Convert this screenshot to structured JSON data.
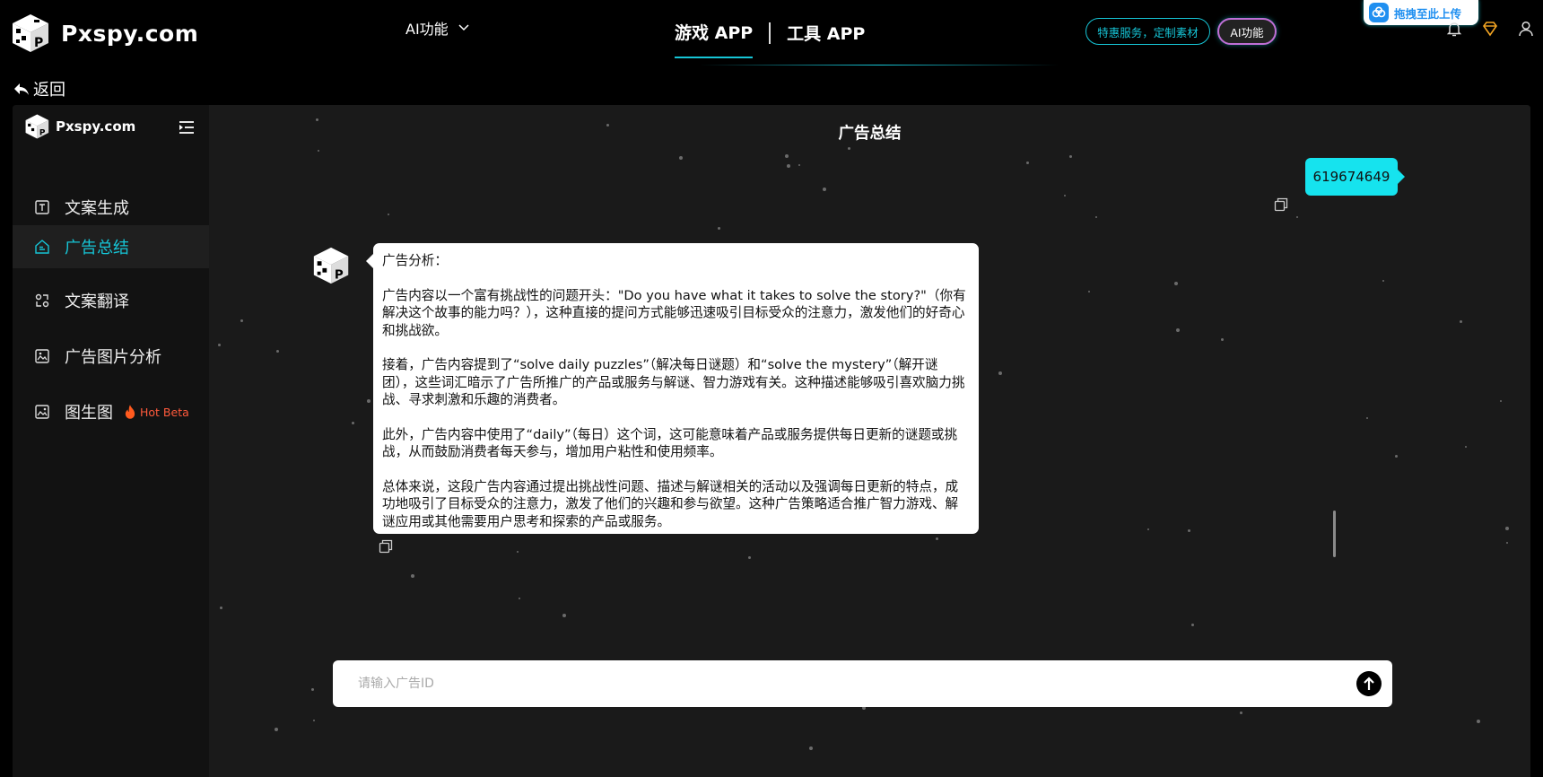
{
  "header": {
    "logo_text": "Pxspy.com",
    "ai_menu_label": "AI功能",
    "tabs": [
      {
        "label": "游戏 APP",
        "active": true
      },
      {
        "label": "工具 APP",
        "active": false
      }
    ],
    "service_pill": "特惠服务，定制素材",
    "ai_pill": "AI功能",
    "upload_banner": "拖拽至此上传",
    "icons": [
      "bell-icon",
      "diamond-icon",
      "user-icon"
    ]
  },
  "nav": {
    "back_label": "返回"
  },
  "sidebar": {
    "logo_text": "Pxspy.com",
    "items": [
      {
        "label": "文案生成",
        "icon": "text-icon",
        "active": false
      },
      {
        "label": "广告总结",
        "icon": "summary-icon",
        "active": true
      },
      {
        "label": "文案翻译",
        "icon": "translate-icon",
        "active": false
      },
      {
        "label": "广告图片分析",
        "icon": "image-analysis-icon",
        "active": false
      },
      {
        "label": "图生图",
        "icon": "image-gen-icon",
        "active": false,
        "badge": "Hot Beta"
      }
    ]
  },
  "chat": {
    "title": "广告总结",
    "user_message": "619674649",
    "bot_paragraphs": [
      "广告分析：",
      "广告内容以一个富有挑战性的问题开头：\"Do you have what it takes to solve the story?\"（你有解决这个故事的能力吗？），这种直接的提问方式能够迅速吸引目标受众的注意力，激发他们的好奇心和挑战欲。",
      "接着，广告内容提到了“solve daily puzzles”（解决每日谜题）和“solve the mystery”（解开谜团），这些词汇暗示了广告所推广的产品或服务与解谜、智力游戏有关。这种描述能够吸引喜欢脑力挑战、寻求刺激和乐趣的消费者。",
      "此外，广告内容中使用了“daily”（每日）这个词，这可能意味着产品或服务提供每日更新的谜题或挑战，从而鼓励消费者每天参与，增加用户粘性和使用频率。",
      "总体来说，这段广告内容通过提出挑战性问题、描述与解谜相关的活动以及强调每日更新的特点，成功地吸引了目标受众的注意力，激发了他们的兴趣和参与欲望。这种广告策略适合推广智力游戏、解谜应用或其他需要用户思考和探索的产品或服务。"
    ],
    "input_placeholder": "请输入广告ID",
    "input_value": ""
  },
  "colors": {
    "accent": "#16c5d6",
    "user_bubble": "#16e3ee",
    "badge": "#ff5a3c"
  }
}
